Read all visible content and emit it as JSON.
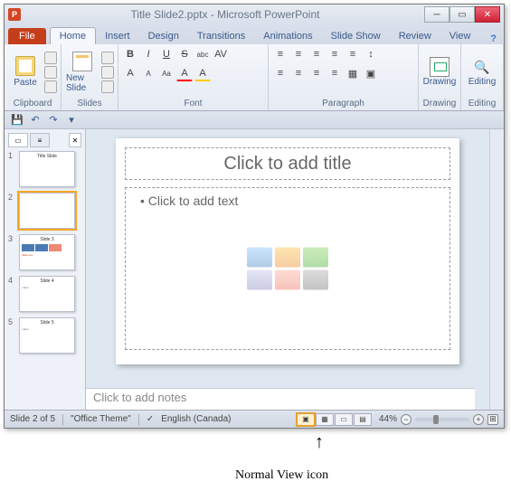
{
  "window": {
    "app_badge": "P",
    "title": "Title Slide2.pptx - Microsoft PowerPoint",
    "min": "─",
    "max": "▭",
    "close": "✕"
  },
  "tabs": {
    "file": "File",
    "home": "Home",
    "insert": "Insert",
    "design": "Design",
    "transitions": "Transitions",
    "animations": "Animations",
    "slideshow": "Slide Show",
    "review": "Review",
    "view": "View",
    "help": "?"
  },
  "ribbon": {
    "clipboard": {
      "label": "Clipboard",
      "paste": "Paste"
    },
    "slides": {
      "label": "Slides",
      "newslide": "New Slide"
    },
    "font": {
      "label": "Font",
      "bold": "B",
      "italic": "I",
      "underline": "U",
      "strike": "S",
      "shadow": "abc",
      "grow": "A",
      "shrink": "A",
      "clear": "Aa"
    },
    "paragraph": {
      "label": "Paragraph",
      "bullets": "≡",
      "numbers": "≡",
      "indent_dec": "≡",
      "indent_inc": "≡",
      "align_l": "≡",
      "align_c": "≡",
      "align_r": "≡",
      "align_j": "≡"
    },
    "drawing": {
      "label": "Drawing",
      "btn": "Drawing"
    },
    "editing": {
      "label": "Editing",
      "btn": "Editing",
      "icon": "🔍"
    }
  },
  "qat": {
    "save": "💾",
    "undo": "↶",
    "redo": "↷",
    "down": "▾"
  },
  "thumbs": {
    "tab_slides": "▭",
    "tab_outline": "≡",
    "close": "✕",
    "items": [
      {
        "n": "1",
        "title": "Title Slide"
      },
      {
        "n": "2",
        "title": ""
      },
      {
        "n": "3",
        "title": "Slide 3"
      },
      {
        "n": "4",
        "title": "Slide 4"
      },
      {
        "n": "5",
        "title": "Slide 5"
      }
    ]
  },
  "slide": {
    "title_placeholder": "Click to add title",
    "body_placeholder": "Click to add text",
    "bullet": "•"
  },
  "notes": {
    "placeholder": "Click to add notes"
  },
  "status": {
    "slide_info": "Slide 2 of 5",
    "theme": "\"Office Theme\"",
    "lang_icon": "✓",
    "language": "English (Canada)",
    "zoom_pct": "44%",
    "minus": "−",
    "plus": "+",
    "fit": "⊞"
  },
  "annotation": {
    "arrow": "↑",
    "label": "Normal View icon"
  }
}
